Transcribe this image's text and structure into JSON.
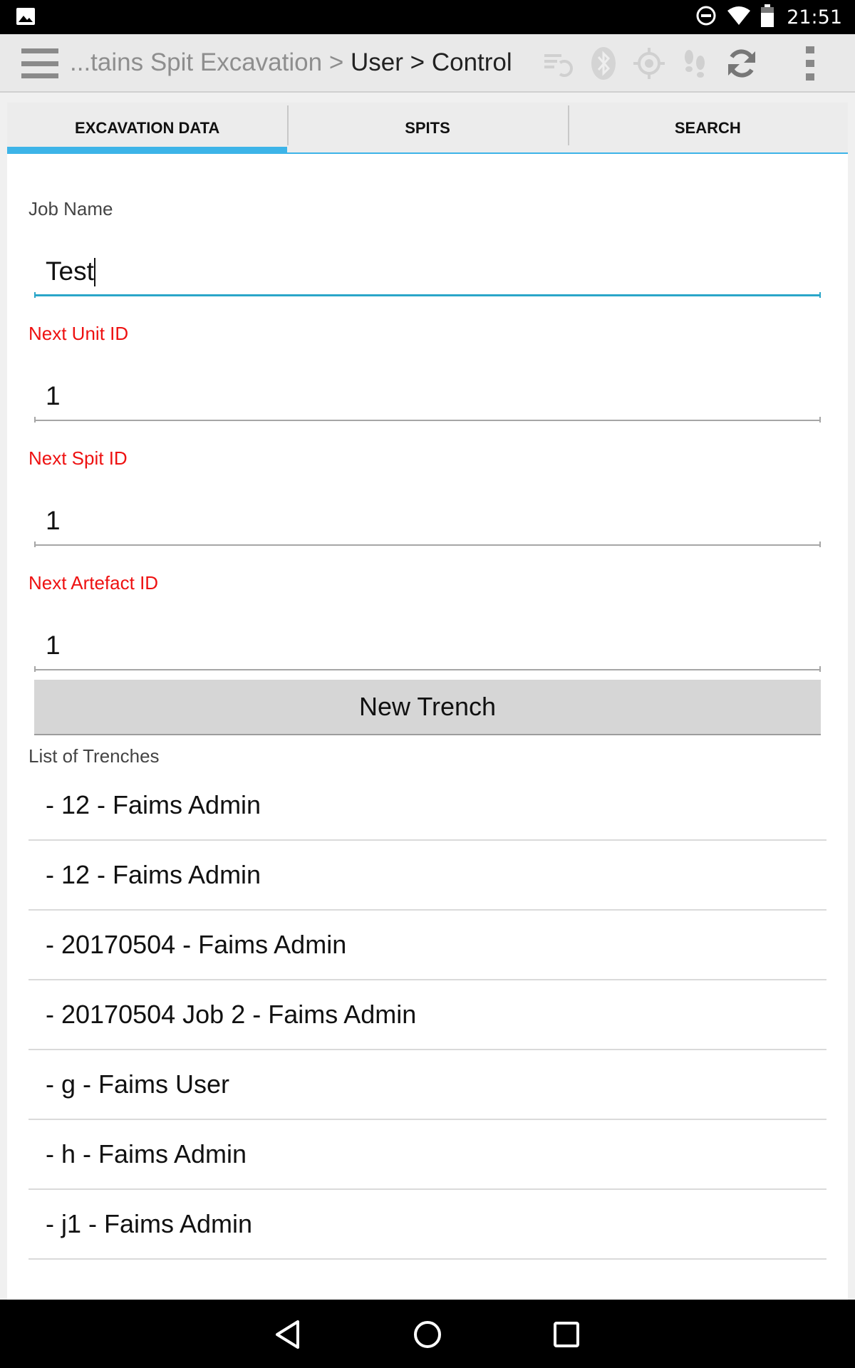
{
  "status_bar": {
    "time": "21:51",
    "left_icon": "image-notification-icon",
    "right_icons": [
      "do-not-disturb-icon",
      "wifi-icon",
      "battery-icon"
    ]
  },
  "action_bar": {
    "breadcrumb": {
      "module": "...tains Spit Excavation",
      "separator_1": ">",
      "user": "User",
      "separator_2": ">",
      "current": "Control"
    },
    "icons": [
      "menu-icon",
      "sync-status-icon",
      "bluetooth-icon",
      "gps-icon",
      "tracking-icon",
      "sync-icon",
      "overflow-menu-icon"
    ]
  },
  "tabs": [
    {
      "label": "EXCAVATION DATA",
      "active": true
    },
    {
      "label": "SPITS",
      "active": false
    },
    {
      "label": "SEARCH",
      "active": false
    }
  ],
  "form": {
    "job_name": {
      "label": "Job Name",
      "value": "Test"
    },
    "next_unit_id": {
      "label": "Next Unit ID",
      "value": "1"
    },
    "next_spit_id": {
      "label": "Next Spit ID",
      "value": "1"
    },
    "next_artefact_id": {
      "label": "Next Artefact ID",
      "value": "1"
    },
    "new_trench_button": "New Trench"
  },
  "trenches": {
    "label": "List of Trenches",
    "items": [
      "- 12 - Faims Admin",
      "- 12 - Faims Admin",
      "- 20170504 - Faims Admin",
      "- 20170504 Job 2 - Faims Admin",
      "- g - Faims User",
      "- h - Faims Admin",
      "- j1 - Faims Admin"
    ]
  },
  "colors": {
    "accent": "#3db4e8",
    "required_label": "#ee1111",
    "focused_input": "#2aa6c9"
  },
  "nav_bar": [
    "back-icon",
    "home-icon",
    "recents-icon"
  ]
}
